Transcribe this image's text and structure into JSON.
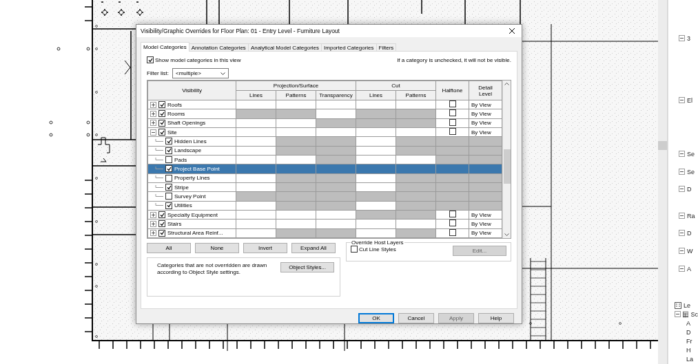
{
  "window": {
    "title": "Visibility/Graphic Overrides for Floor Plan: 01 - Entry Level - Furniture Layout"
  },
  "tabs": [
    {
      "label": "Model Categories",
      "selected": true
    },
    {
      "label": "Annotation Categories",
      "selected": false
    },
    {
      "label": "Analytical Model Categories",
      "selected": false
    },
    {
      "label": "Imported Categories",
      "selected": false
    },
    {
      "label": "Filters",
      "selected": false
    }
  ],
  "show_categories": {
    "label": "Show model categories in this view",
    "checked": true
  },
  "hint": "If a category is unchecked, it will not be visible.",
  "filter": {
    "label": "Filter list:",
    "value": "<multiple>"
  },
  "table": {
    "columns": [
      {
        "label": "Visibility"
      },
      {
        "label": "Projection/Surface",
        "children": [
          "Lines",
          "Patterns",
          "Transparency"
        ]
      },
      {
        "label": "Cut",
        "children": [
          "Lines",
          "Patterns"
        ]
      },
      {
        "label": "Halftone"
      },
      {
        "label": "Detail Level"
      }
    ],
    "rows": [
      {
        "name": "Roofs",
        "kind": "category",
        "expanded": false,
        "checked": true,
        "selected": false,
        "shaded": [
          false,
          false,
          false,
          false,
          false,
          false,
          false
        ],
        "halftone": false,
        "detail_level": "By View"
      },
      {
        "name": "Rooms",
        "kind": "category",
        "expanded": false,
        "checked": true,
        "selected": false,
        "shaded": [
          true,
          true,
          false,
          true,
          true,
          false,
          false
        ],
        "halftone": false,
        "detail_level": "By View"
      },
      {
        "name": "Shaft Openings",
        "kind": "category",
        "expanded": false,
        "checked": true,
        "selected": false,
        "shaded": [
          false,
          false,
          true,
          true,
          true,
          false,
          false
        ],
        "halftone": false,
        "detail_level": "By View"
      },
      {
        "name": "Site",
        "kind": "category",
        "expanded": true,
        "checked": true,
        "selected": false,
        "shaded": [
          false,
          false,
          false,
          false,
          false,
          false,
          false
        ],
        "halftone": false,
        "detail_level": "By View"
      },
      {
        "name": "Hidden Lines",
        "kind": "subcategory",
        "checked": true,
        "selected": false,
        "shaded": [
          false,
          true,
          true,
          false,
          true,
          true,
          true
        ]
      },
      {
        "name": "Landscape",
        "kind": "subcategory",
        "checked": true,
        "selected": false,
        "shaded": [
          false,
          true,
          true,
          false,
          true,
          true,
          true
        ]
      },
      {
        "name": "Pads",
        "kind": "subcategory",
        "checked": false,
        "selected": false,
        "shaded": [
          false,
          false,
          true,
          false,
          false,
          true,
          true
        ]
      },
      {
        "name": "Project Base Point",
        "kind": "subcategory",
        "checked": true,
        "selected": true
      },
      {
        "name": "Property Lines",
        "kind": "subcategory",
        "checked": false,
        "selected": false,
        "shaded": [
          false,
          true,
          true,
          false,
          true,
          true,
          true
        ]
      },
      {
        "name": "Stripe",
        "kind": "subcategory",
        "checked": true,
        "selected": false,
        "shaded": [
          false,
          true,
          true,
          false,
          true,
          true,
          true
        ]
      },
      {
        "name": "Survey Point",
        "kind": "subcategory",
        "checked": false,
        "selected": false,
        "shaded": [
          true,
          true,
          true,
          true,
          true,
          true,
          true
        ]
      },
      {
        "name": "Utilities",
        "kind": "subcategory",
        "checked": true,
        "selected": false,
        "shaded": [
          false,
          true,
          true,
          false,
          true,
          true,
          true
        ]
      },
      {
        "name": "Specialty Equipment",
        "kind": "category",
        "expanded": false,
        "checked": true,
        "selected": false,
        "shaded": [
          false,
          false,
          false,
          true,
          true,
          false,
          false
        ],
        "halftone": false,
        "detail_level": "By View"
      },
      {
        "name": "Stairs",
        "kind": "category",
        "expanded": false,
        "checked": true,
        "selected": false,
        "shaded": [
          false,
          false,
          false,
          false,
          false,
          false,
          false
        ],
        "halftone": false,
        "detail_level": "By View"
      },
      {
        "name": "Structural Area Reinf...",
        "kind": "category",
        "expanded": false,
        "checked": true,
        "selected": false,
        "shaded": [
          false,
          true,
          true,
          false,
          true,
          false,
          false
        ],
        "halftone": false,
        "detail_level": "By View"
      }
    ]
  },
  "list_buttons": [
    "All",
    "None",
    "Invert",
    "Expand All"
  ],
  "info": {
    "text": "Categories that are not overridden are drawn according to Object Style settings.",
    "button": "Object Styles..."
  },
  "override_host_layers": {
    "title": "Override Host Layers",
    "checkbox": {
      "label": "Cut Line Styles",
      "checked": false
    },
    "button": {
      "label": "Edit...",
      "disabled": true
    }
  },
  "buttons": [
    {
      "label": "OK",
      "default": true,
      "disabled": false
    },
    {
      "label": "Cancel",
      "default": false,
      "disabled": false
    },
    {
      "label": "Apply",
      "default": false,
      "disabled": true
    },
    {
      "label": "Help",
      "default": false,
      "disabled": false
    }
  ],
  "project_browser": {
    "items": [
      {
        "label": "3",
        "kind": "group",
        "expanded": true
      },
      {
        "label": "El",
        "kind": "group",
        "expanded": true
      },
      {
        "label": "Se",
        "kind": "group",
        "expanded": true
      },
      {
        "label": "Se",
        "kind": "group",
        "expanded": true
      },
      {
        "label": "D",
        "kind": "group",
        "expanded": true
      },
      {
        "label": "Ra",
        "kind": "group",
        "expanded": true
      },
      {
        "label": "D",
        "kind": "group",
        "expanded": true
      },
      {
        "label": "W",
        "kind": "group",
        "expanded": true
      },
      {
        "label": "A",
        "kind": "group",
        "expanded": true
      },
      {
        "label": "Le",
        "kind": "legend"
      },
      {
        "label": "Sc",
        "kind": "schedule",
        "expanded": true,
        "children": [
          {
            "label": "A"
          },
          {
            "label": "D"
          },
          {
            "label": "Fr"
          },
          {
            "label": "H"
          },
          {
            "label": "La"
          }
        ]
      }
    ]
  }
}
